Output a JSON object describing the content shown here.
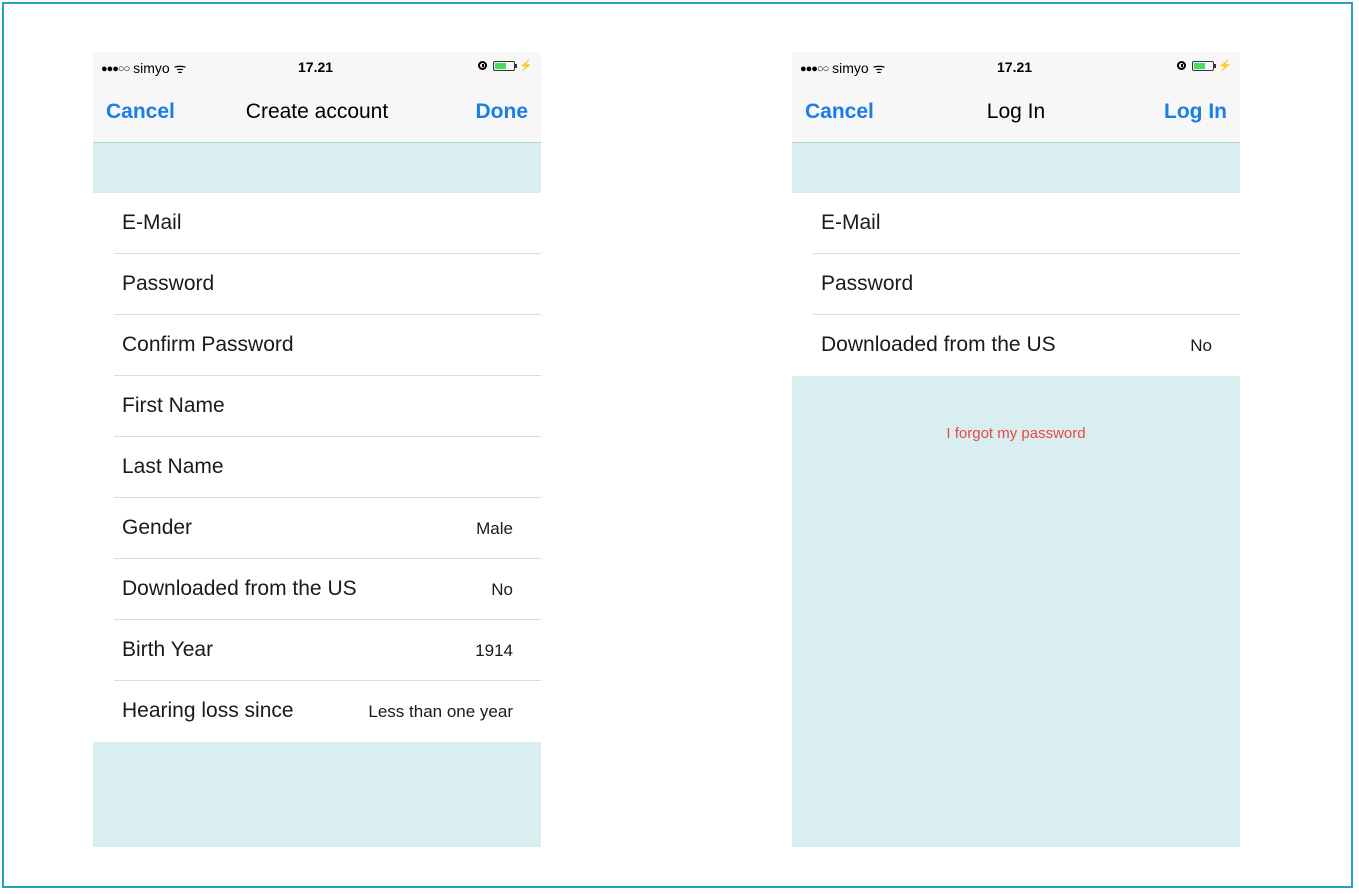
{
  "status_bar": {
    "signal_dots": "●●●○○",
    "carrier": "simyo",
    "wifi_icon": "ᯤ",
    "time": "17.21",
    "alarm_icon": "alarm-clock",
    "battery_level": 0.55,
    "charging_icon": "⚡"
  },
  "create_account": {
    "nav": {
      "cancel_label": "Cancel",
      "title": "Create account",
      "done_label": "Done"
    },
    "fields": [
      {
        "label": "E-Mail",
        "value": ""
      },
      {
        "label": "Password",
        "value": ""
      },
      {
        "label": "Confirm Password",
        "value": ""
      },
      {
        "label": "First Name",
        "value": ""
      },
      {
        "label": "Last Name",
        "value": ""
      },
      {
        "label": "Gender",
        "value": "Male"
      },
      {
        "label": "Downloaded from the US",
        "value": "No"
      },
      {
        "label": "Birth Year",
        "value": "1914"
      },
      {
        "label": "Hearing loss since",
        "value": "Less than one year"
      }
    ]
  },
  "log_in": {
    "nav": {
      "cancel_label": "Cancel",
      "title": "Log In",
      "login_label": "Log In"
    },
    "fields": [
      {
        "label": "E-Mail",
        "value": ""
      },
      {
        "label": "Password",
        "value": ""
      },
      {
        "label": "Downloaded from the US",
        "value": "No"
      }
    ],
    "forgot_password": "I forgot my password"
  },
  "colors": {
    "accent": "#1a7ee6",
    "background": "#d9eef1",
    "link_red": "#e8493f",
    "frame_border": "#2a9fc0"
  }
}
